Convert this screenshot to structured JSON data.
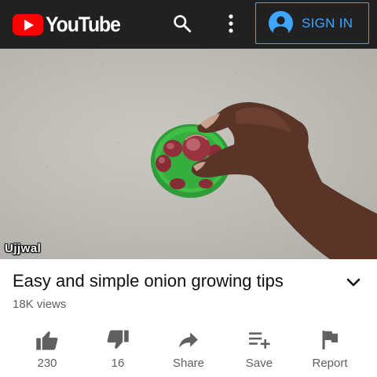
{
  "header": {
    "logo_text": "YouTube",
    "sign_in_label": "SIGN IN",
    "icons": [
      "youtube-logo-icon",
      "search-icon",
      "more-vertical-icon",
      "account-circle-icon"
    ]
  },
  "video": {
    "watermark": "Ujjwal"
  },
  "details": {
    "title": "Easy and simple onion growing tips",
    "views": "18K views",
    "expand_icon": "chevron-down-icon"
  },
  "actions": {
    "like": {
      "label": "230",
      "icon": "thumbs-up-icon"
    },
    "dislike": {
      "label": "16",
      "icon": "thumbs-down-icon"
    },
    "share": {
      "label": "Share",
      "icon": "share-icon"
    },
    "save": {
      "label": "Save",
      "icon": "playlist-add-icon"
    },
    "report": {
      "label": "Report",
      "icon": "flag-icon"
    }
  },
  "colors": {
    "header_bg": "#212121",
    "brand_red": "#ff0000",
    "accent_blue": "#3ea6ff",
    "secondary_text": "#606060"
  }
}
